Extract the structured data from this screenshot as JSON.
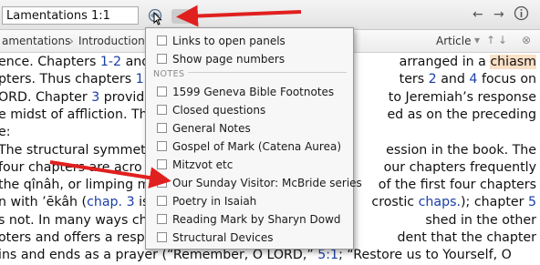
{
  "toolbar": {
    "reference_value": "Lamentations 1:1",
    "icons": [
      "link-panels-icon",
      "dropdown-icon",
      "back-arrow-icon",
      "forward-arrow-icon",
      "info-icon"
    ]
  },
  "subbar": {
    "crumb1": "amentations",
    "crumb2": "Introduction",
    "article_label": "Article"
  },
  "article": {
    "lines": [
      {
        "parts": [
          {
            "t": "ence. Chapters "
          },
          {
            "t": "1-2",
            "c": "ref"
          },
          {
            "t": " and"
          }
        ],
        "right": [
          {
            "t": "arranged in a "
          },
          {
            "t": "chiasm",
            "c": "hl"
          }
        ]
      },
      {
        "parts": [
          {
            "t": "pters. Thus chapters "
          },
          {
            "t": "1",
            "c": "ref"
          },
          {
            "t": " ar"
          }
        ],
        "right": [
          {
            "t": "ters "
          },
          {
            "t": "2",
            "c": "ref"
          },
          {
            "t": " and "
          },
          {
            "t": "4",
            "c": "ref"
          },
          {
            "t": " focus on"
          }
        ]
      },
      {
        "parts": [
          {
            "t": "ORD. Chapter "
          },
          {
            "t": "3",
            "c": "ref"
          },
          {
            "t": " provide"
          }
        ],
        "right": [
          {
            "t": " to Jeremiah’s response"
          }
        ]
      },
      {
        "parts": [
          {
            "t": "e midst of affliction. Th"
          }
        ],
        "right": [
          {
            "t": "ed as on the preceding"
          }
        ]
      },
      {
        "parts": [
          {
            "t": "e:"
          }
        ],
        "right": []
      },
      {
        "parts": [
          {
            "t": "The structural symmetr"
          }
        ],
        "right": [
          {
            "t": "ession in the book. The"
          }
        ]
      },
      {
        "parts": [
          {
            "t": "four chapters are acro"
          }
        ],
        "right": [
          {
            "t": "our chapters frequently"
          }
        ]
      },
      {
        "parts": [
          {
            "t": "the qînâh, or limping m"
          }
        ],
        "right": [
          {
            "t": "of the first four chapters"
          }
        ]
      },
      {
        "parts": [
          {
            "t": "n with ’ēkâh ("
          },
          {
            "t": "chap. 3",
            "c": "ref"
          },
          {
            "t": " is"
          }
        ],
        "right": [
          {
            "t": "crostic "
          },
          {
            "t": "chaps.",
            "c": "ref"
          },
          {
            "t": "); chapter "
          },
          {
            "t": "5",
            "c": "ref"
          }
        ]
      },
      {
        "parts": [
          {
            "t": "s not. In many ways ch"
          }
        ],
        "right": [
          {
            "t": "shed in the other"
          }
        ]
      },
      {
        "parts": [
          {
            "t": "oters and offers a respo"
          }
        ],
        "right": [
          {
            "t": "dent that the chapter"
          }
        ]
      },
      {
        "parts": [
          {
            "t": "ins and ends as a prayer (“Remember, O LORD,” "
          },
          {
            "t": "5:1",
            "c": "ref"
          },
          {
            "t": "; “Restore us to Yourself, O"
          }
        ],
        "right": []
      }
    ]
  },
  "menu": {
    "items_top": [
      {
        "label": "Links to open panels",
        "checked": false
      },
      {
        "label": "Show page numbers",
        "checked": false
      }
    ],
    "section_label": "NOTES",
    "notes": [
      {
        "label": "1599 Geneva Bible Footnotes",
        "checked": false
      },
      {
        "label": "Closed questions",
        "checked": false
      },
      {
        "label": "General Notes",
        "checked": false
      },
      {
        "label": "Gospel of Mark (Catena Aurea)",
        "checked": false
      },
      {
        "label": "Mitzvot etc",
        "checked": false
      },
      {
        "label": "Our Sunday Visitor: McBride series",
        "checked": true
      },
      {
        "label": "Poetry in Isaiah",
        "checked": false
      },
      {
        "label": "Reading Mark by Sharyn Dowd",
        "checked": false
      },
      {
        "label": "Structural Devices",
        "checked": false
      }
    ]
  },
  "colors": {
    "arrow": "#e0201e",
    "link": "#1a3ea6",
    "highlight": "#fbe0c6"
  }
}
